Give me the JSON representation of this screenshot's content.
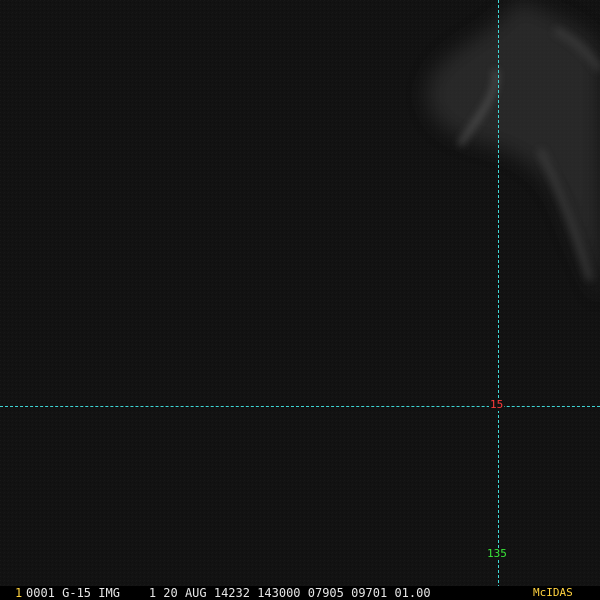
{
  "image": {
    "background": "#121212",
    "cloud_tint": "#8a8a8a"
  },
  "grid": {
    "line_color": "#3fd6d6",
    "latitude_label": "15",
    "latitude_label_color": "#ff3b3b",
    "longitude_label": "135",
    "longitude_label_color": "#39e639"
  },
  "status_bar": {
    "frame_number": "1",
    "text": "0001 G-15 IMG    1 20 AUG 14232 143000 07905 09701 01.00",
    "brand": "McIDAS",
    "accent_color": "#ffd23f",
    "text_color": "#e6e6e6"
  }
}
